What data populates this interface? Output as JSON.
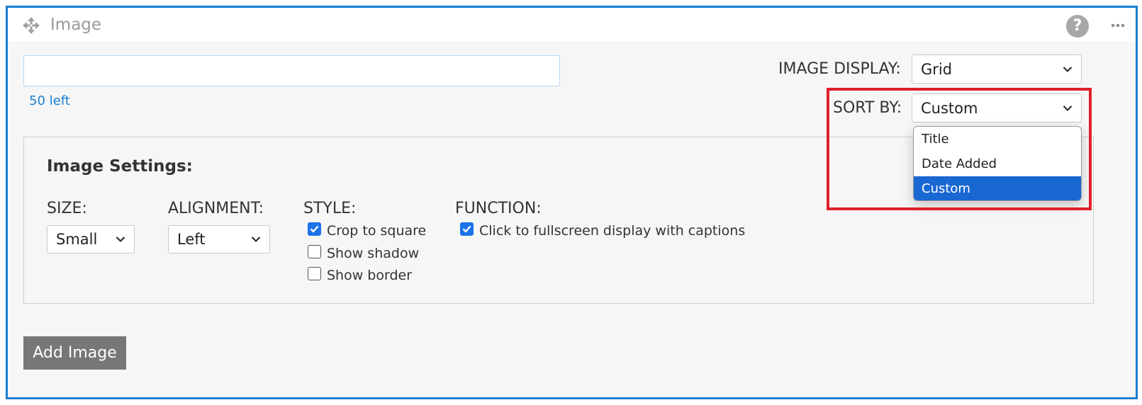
{
  "header": {
    "title": "Image",
    "help_label": "?"
  },
  "caption_input": {
    "value": "",
    "counter": "50 left"
  },
  "image_display": {
    "label": "IMAGE DISPLAY:",
    "value": "Grid"
  },
  "sort_by": {
    "label": "SORT BY:",
    "value": "Custom",
    "options": [
      "Title",
      "Date Added",
      "Custom"
    ],
    "selected_index": 2
  },
  "settings": {
    "title": "Image Settings:",
    "size": {
      "label": "SIZE:",
      "value": "Small"
    },
    "alignment": {
      "label": "ALIGNMENT:",
      "value": "Left"
    },
    "style": {
      "label": "STYLE:",
      "options": [
        {
          "label": "Crop to square",
          "checked": true
        },
        {
          "label": "Show shadow",
          "checked": false
        },
        {
          "label": "Show border",
          "checked": false
        }
      ]
    },
    "function": {
      "label": "FUNCTION:",
      "options": [
        {
          "label": "Click to fullscreen display with captions",
          "checked": true
        }
      ]
    }
  },
  "add_button": {
    "label": "Add Image"
  },
  "colors": {
    "accent": "#1a7fd0",
    "highlight": "#e0202a",
    "selected": "#1967d2"
  }
}
